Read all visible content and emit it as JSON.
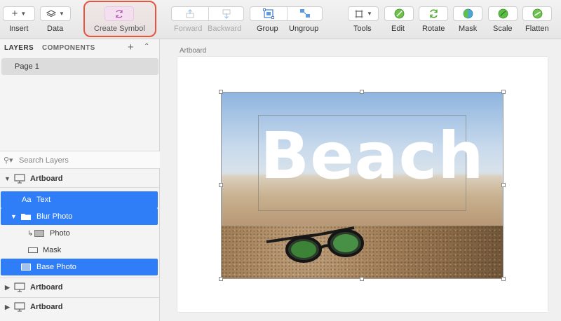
{
  "toolbar": {
    "insert": {
      "label": "Insert",
      "icon": "plus-icon"
    },
    "data": {
      "label": "Data",
      "icon": "layers-stack-icon"
    },
    "create_symbol": {
      "label": "Create Symbol",
      "icon": "create-symbol-icon",
      "highlighted": true,
      "highlight_color": "#e6553c"
    },
    "forward": {
      "label": "Forward",
      "enabled": false
    },
    "backward": {
      "label": "Backward",
      "enabled": false
    },
    "group": {
      "label": "Group"
    },
    "ungroup": {
      "label": "Ungroup"
    },
    "tools": {
      "label": "Tools"
    },
    "edit": {
      "label": "Edit"
    },
    "rotate": {
      "label": "Rotate"
    },
    "mask": {
      "label": "Mask"
    },
    "scale": {
      "label": "Scale"
    },
    "flatten": {
      "label": "Flatten"
    }
  },
  "sidebar": {
    "tabs": {
      "layers": "LAYERS",
      "components": "COMPONENTS"
    },
    "pages": [
      "Page 1"
    ],
    "search": {
      "placeholder": "Search Layers"
    },
    "layers": {
      "artboard_1": "Artboard",
      "text": "Text",
      "text_icon": "Aa",
      "blur_photo": "Blur Photo",
      "photo": "Photo",
      "mask": "Mask",
      "base_photo": "Base Photo",
      "artboard_2": "Artboard",
      "artboard_3": "Artboard"
    },
    "selection_color": "#2f7ef8"
  },
  "canvas": {
    "artboard_name": "Artboard",
    "headline": "Beach"
  }
}
